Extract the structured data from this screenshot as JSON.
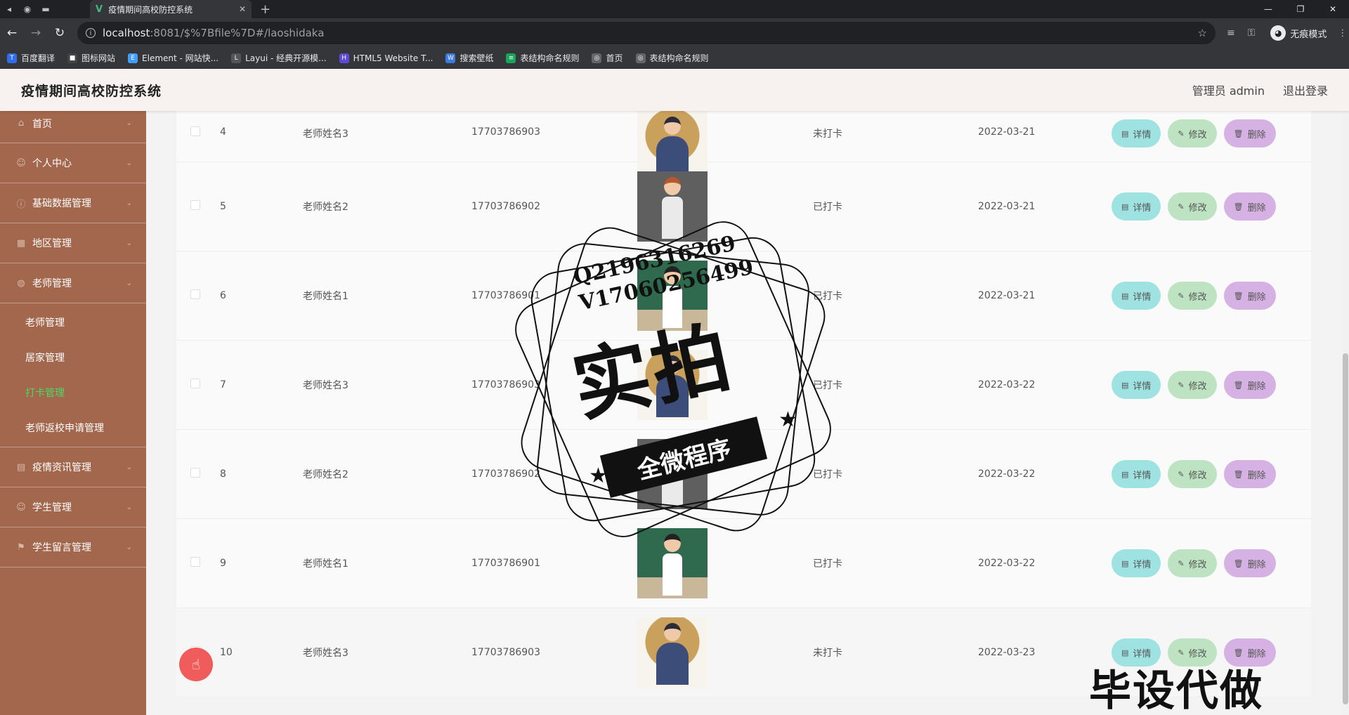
{
  "browser": {
    "tab_title": "疫情期间高校防控系统",
    "url_host": "localhost",
    "url_path": ":8081/$%7Bfile%7D#/laoshidaka",
    "incognito_label": "无痕模式",
    "bookmarks": [
      {
        "label": "百度翻译",
        "color": "#2f6ee8",
        "glyph": "T"
      },
      {
        "label": "图标网站",
        "color": "#444444",
        "glyph": "■"
      },
      {
        "label": "Element - 网站快...",
        "color": "#409eff",
        "glyph": "E"
      },
      {
        "label": "Layui - 经典开源模...",
        "color": "#555555",
        "glyph": "L"
      },
      {
        "label": "HTML5 Website T...",
        "color": "#5b4bd6",
        "glyph": "H"
      },
      {
        "label": "搜索壁纸",
        "color": "#3c7be0",
        "glyph": "W"
      },
      {
        "label": "表结构命名规则",
        "color": "#1aa35a",
        "glyph": "≡"
      },
      {
        "label": "首页",
        "color": "#666666",
        "glyph": "◎"
      },
      {
        "label": "表结构命名规则",
        "color": "#666666",
        "glyph": "◎"
      }
    ]
  },
  "header": {
    "title": "疫情期间高校防控系统",
    "admin": "管理员 admin",
    "logout": "退出登录"
  },
  "sidebar": {
    "items": [
      {
        "label": "首页",
        "icon": "home-icon"
      },
      {
        "label": "个人中心",
        "icon": "user-icon"
      },
      {
        "label": "基础数据管理",
        "icon": "info-icon"
      },
      {
        "label": "地区管理",
        "icon": "grid-icon"
      },
      {
        "label": "老师管理",
        "icon": "teacher-icon"
      }
    ],
    "sub_items": [
      "老师管理",
      "居家管理",
      "打卡管理",
      "老师返校申请管理"
    ],
    "active_sub": "打卡管理",
    "items_after": [
      {
        "label": "疫情资讯管理",
        "icon": "news-icon"
      },
      {
        "label": "学生管理",
        "icon": "student-icon"
      },
      {
        "label": "学生留言管理",
        "icon": "flag-icon"
      }
    ]
  },
  "table": {
    "rows": [
      {
        "no": "4",
        "name": "老师姓名3",
        "phone": "17703786903",
        "photo": "a",
        "status": "未打卡",
        "date": "2022-03-21"
      },
      {
        "no": "5",
        "name": "老师姓名2",
        "phone": "17703786902",
        "photo": "b",
        "status": "已打卡",
        "date": "2022-03-21"
      },
      {
        "no": "6",
        "name": "老师姓名1",
        "phone": "17703786901",
        "photo": "c",
        "status": "已打卡",
        "date": "2022-03-21"
      },
      {
        "no": "7",
        "name": "老师姓名3",
        "phone": "17703786903",
        "photo": "a",
        "status": "已打卡",
        "date": "2022-03-22"
      },
      {
        "no": "8",
        "name": "老师姓名2",
        "phone": "17703786902",
        "photo": "b",
        "status": "已打卡",
        "date": "2022-03-22"
      },
      {
        "no": "9",
        "name": "老师姓名1",
        "phone": "17703786901",
        "photo": "c",
        "status": "已打卡",
        "date": "2022-03-22"
      },
      {
        "no": "10",
        "name": "老师姓名3",
        "phone": "17703786903",
        "photo": "a",
        "status": "未打卡",
        "date": "2022-03-23"
      }
    ],
    "actions": {
      "detail": "详情",
      "edit": "修改",
      "delete": "删除"
    }
  },
  "watermark": {
    "contact_q": "Q2196316269",
    "contact_v": "V17060256499",
    "big_text": "实拍",
    "band_text": "全微程序",
    "corner_text": "毕设代做"
  }
}
